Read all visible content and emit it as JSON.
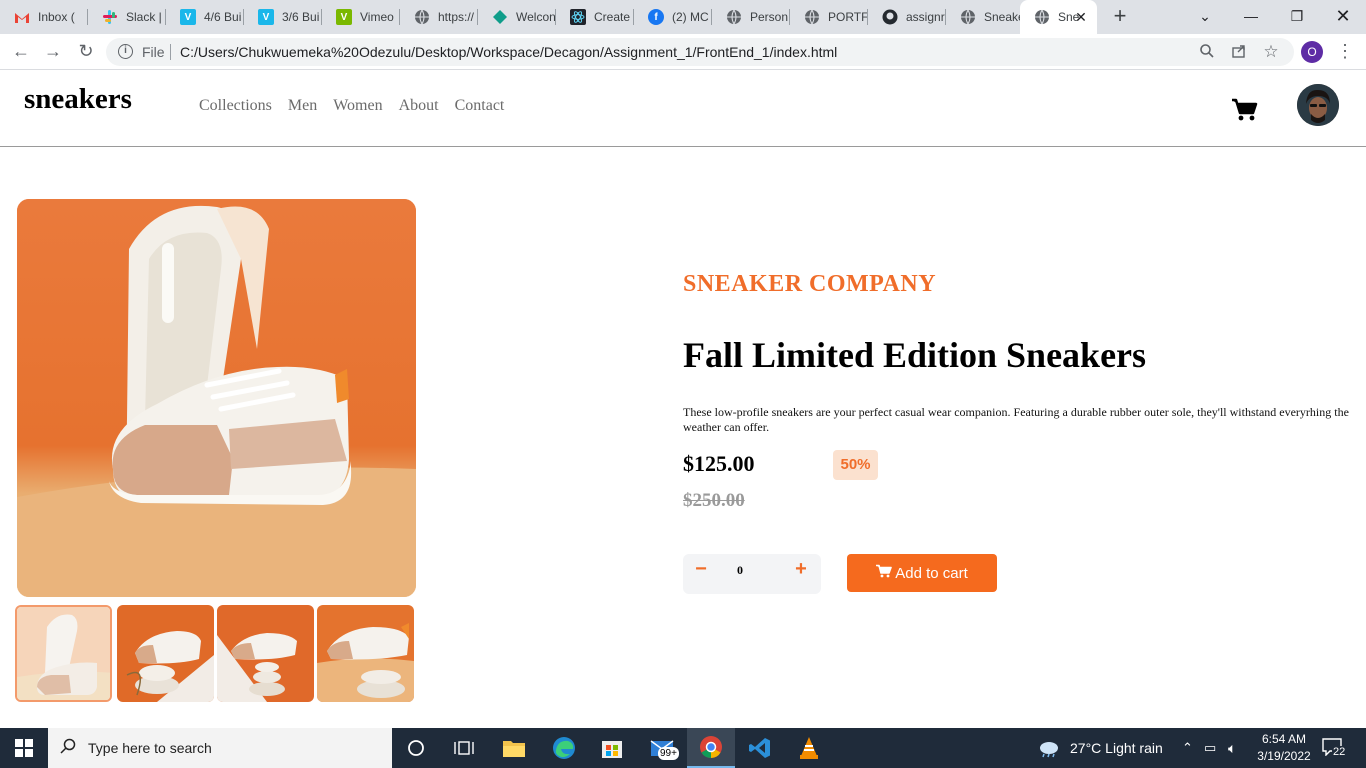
{
  "browser": {
    "tabs": [
      {
        "label": "Inbox (",
        "icon": "gmail-icon",
        "color": "#ea4335",
        "glyph": "M"
      },
      {
        "label": "Slack |",
        "icon": "slack-icon",
        "color": "#611f69",
        "glyph": "#"
      },
      {
        "label": "4/6 Bui",
        "icon": "vimeo-icon",
        "color": "#1ab7ea",
        "glyph": "V"
      },
      {
        "label": "3/6 Bui",
        "icon": "vimeo-icon",
        "color": "#1ab7ea",
        "glyph": "V"
      },
      {
        "label": "Vimeo",
        "icon": "vimeo-icon",
        "color": "#7ab800",
        "glyph": "V"
      },
      {
        "label": "https://",
        "icon": "globe-icon",
        "color": "#5f6368",
        "glyph": ""
      },
      {
        "label": "Welcon",
        "icon": "diamond-icon",
        "color": "#0f9d8a",
        "glyph": ""
      },
      {
        "label": "Create",
        "icon": "react-icon",
        "color": "#20232a",
        "glyph": ""
      },
      {
        "label": "(2) MC",
        "icon": "facebook-icon",
        "color": "#1877f2",
        "glyph": "f"
      },
      {
        "label": "Person",
        "icon": "globe-icon",
        "color": "#5f6368",
        "glyph": ""
      },
      {
        "label": "PORTF",
        "icon": "globe-icon",
        "color": "#5f6368",
        "glyph": ""
      },
      {
        "label": "assignr",
        "icon": "github-icon",
        "color": "#24292f",
        "glyph": ""
      },
      {
        "label": "Sneake",
        "icon": "globe-icon",
        "color": "#5f6368",
        "glyph": ""
      },
      {
        "label": "Sne",
        "icon": "globe-icon",
        "color": "#5f6368",
        "glyph": ""
      }
    ],
    "file_label": "File",
    "url": "C:/Users/Chukwuemeka%20Odezulu/Desktop/Workspace/Decagon/Assignment_1/FrontEnd_1/index.html",
    "profile_initial": "O"
  },
  "site": {
    "logo": "sneakers",
    "nav": [
      "Collections",
      "Men",
      "Women",
      "About",
      "Contact"
    ]
  },
  "product": {
    "company": "SNEAKER COMPANY",
    "title": "Fall Limited Edition Sneakers",
    "description": "These low-profile sneakers are your perfect casual wear companion. Featuring a durable rubber outer sole, they'll withstand everyrhing the weather can offer.",
    "price": "$125.00",
    "discount": "50%",
    "original_price": "$250.00",
    "quantity": "0",
    "minus": "−",
    "plus": "+",
    "add_to_cart": "Add to cart",
    "accent_color": "#f06d2a"
  },
  "taskbar": {
    "search_placeholder": "Type here to search",
    "weather": "27°C  Light rain",
    "time": "6:54 AM",
    "date": "3/19/2022",
    "notification_count": "22",
    "mail_badge": "99+"
  }
}
